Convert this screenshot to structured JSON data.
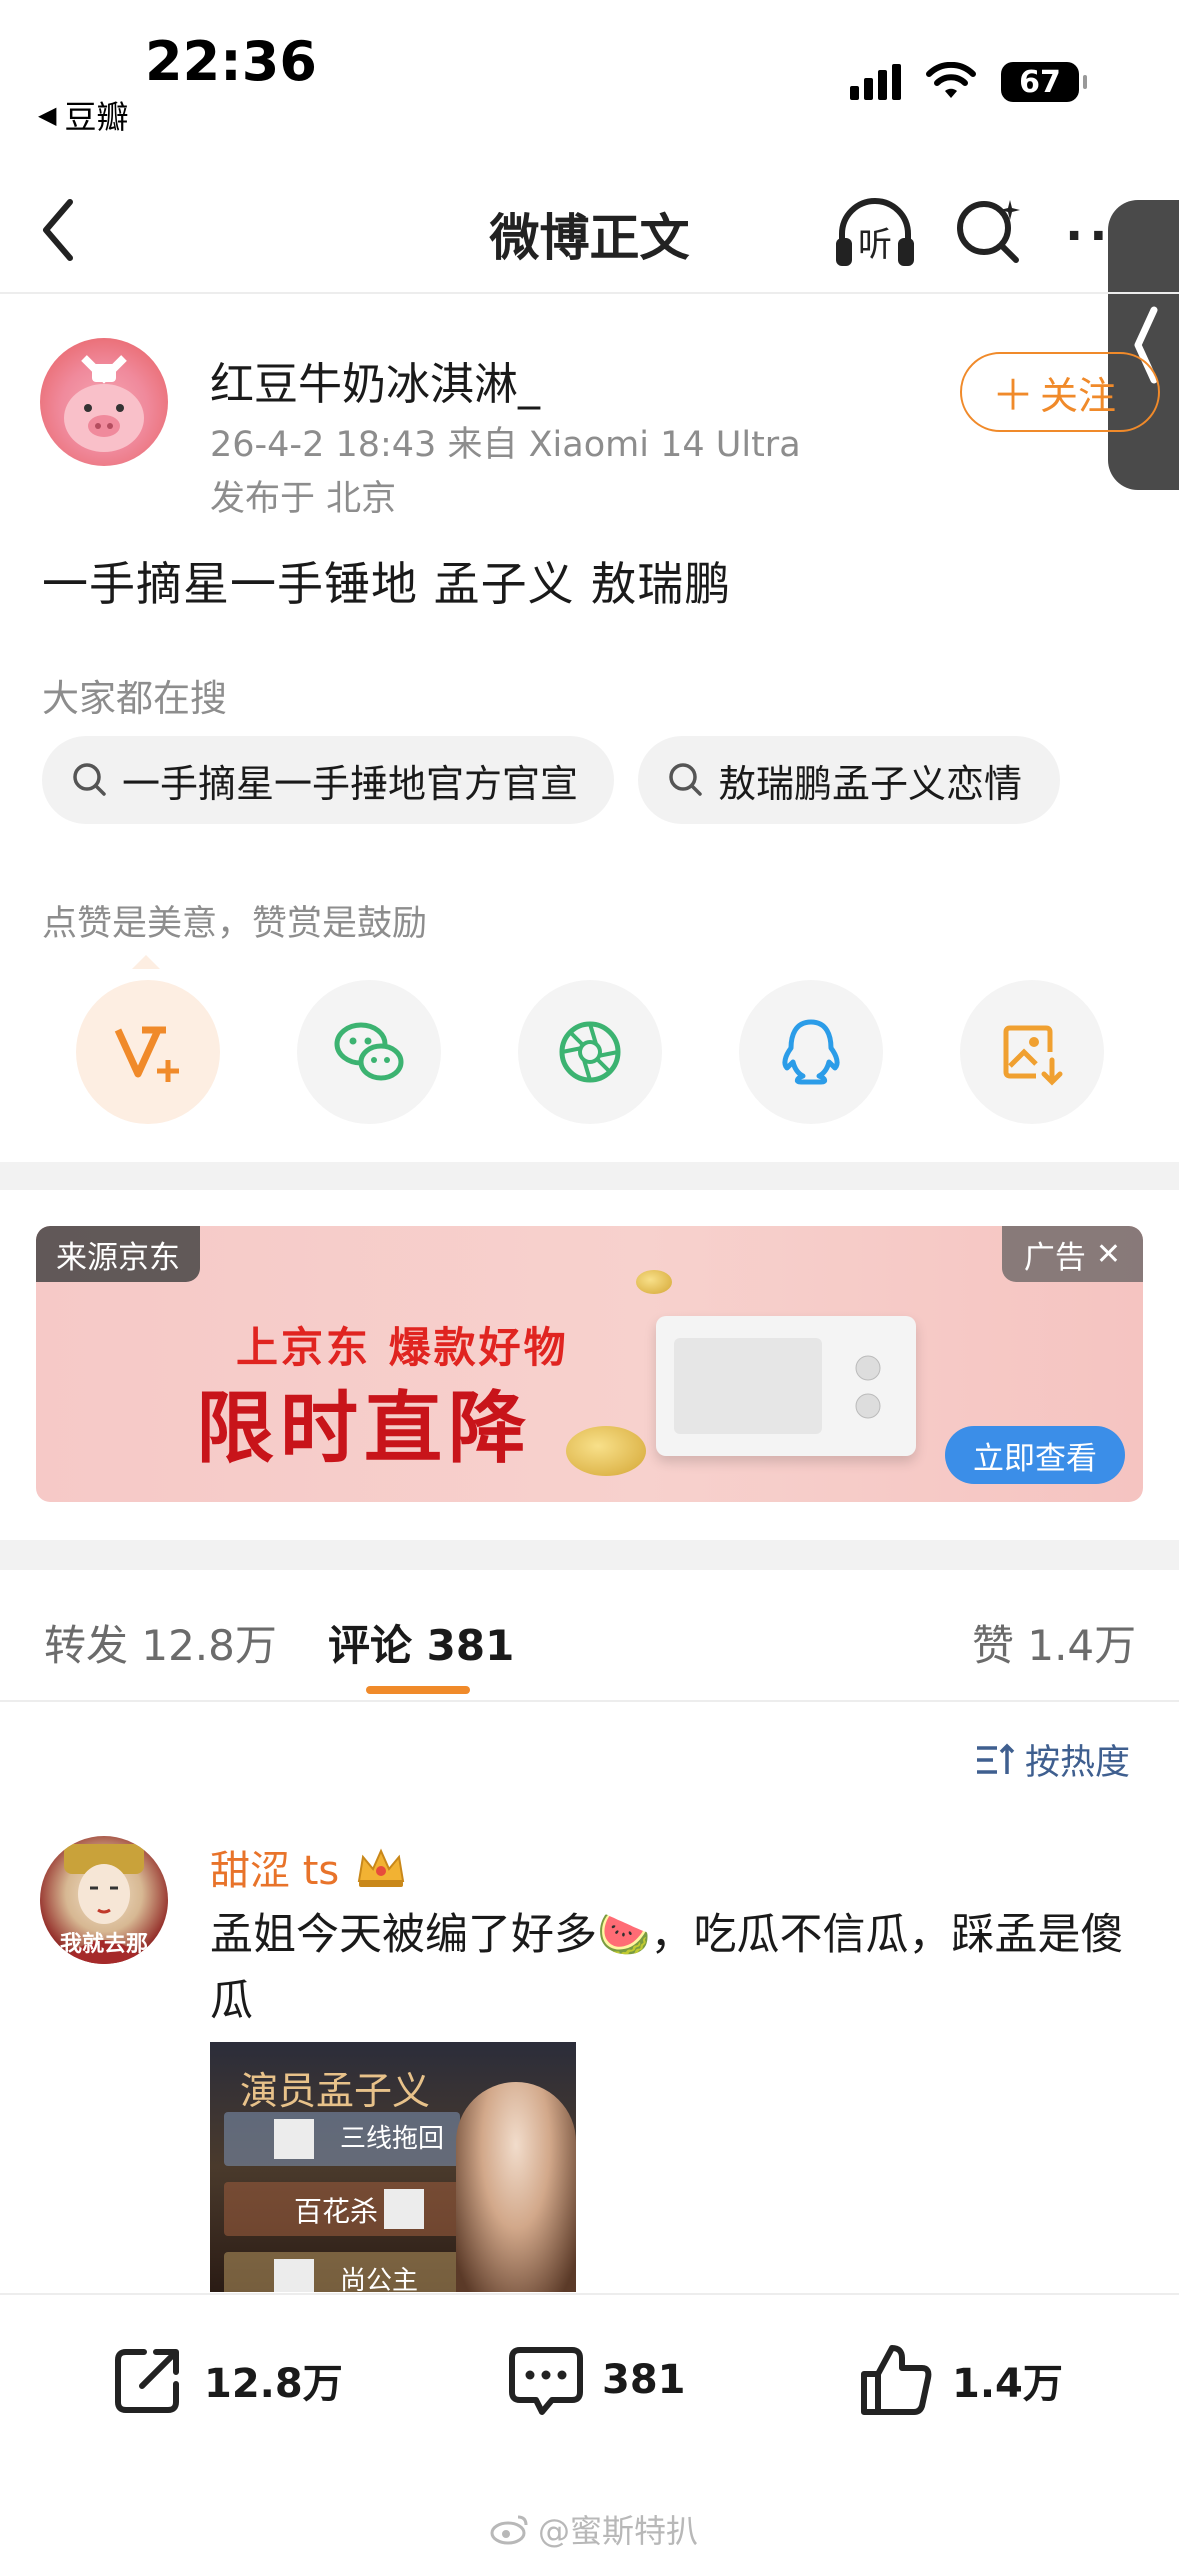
{
  "status_bar": {
    "time": "22:36",
    "back_app": "豆瓣",
    "battery": "67"
  },
  "nav": {
    "title": "微博正文",
    "listen_label": "听"
  },
  "post": {
    "author": "红豆牛奶冰淇淋_",
    "meta": "26-4-2 18:43  来自 Xiaomi 14 Ultra",
    "location": "发布于 北京",
    "follow_label": "关注",
    "text": "一手摘星一手锤地  孟子义 敖瑞鹏"
  },
  "searching": {
    "label": "大家都在搜",
    "chips": [
      "一手摘星一手捶地官方官宣",
      "敖瑞鹏孟子义恋情"
    ]
  },
  "reward": {
    "label": "点赞是美意，赞赏是鼓励",
    "share_icons": [
      "reward-v-plus-icon",
      "wechat-icon",
      "moments-icon",
      "qq-icon",
      "save-image-icon"
    ]
  },
  "ad": {
    "source": "来源京东",
    "tag": "广告",
    "line1": "上京东 爆款好物",
    "line2": "限时直降",
    "button": "立即查看"
  },
  "tabs": {
    "repost": "转发 12.8万",
    "comments": "评论 381",
    "likes": "赞 1.4万"
  },
  "sort_label": "按热度",
  "comment": {
    "author": "甜涩 ts",
    "avatar_text": "我就去那",
    "text": "孟姐今天被编了好多🍉，吃瓜不信瓜，踩孟是傻瓜",
    "image_title": "演员孟子义",
    "image_labels": [
      "三线拖回",
      "百花杀",
      "尚公主"
    ]
  },
  "bottom_bar": {
    "repost": "12.8万",
    "comments": "381",
    "likes": "1.4万"
  },
  "watermark": "@蜜斯特扒",
  "colors": {
    "accent_orange": "#f08a2a",
    "link_blue": "#3f5f8f",
    "ad_red": "#c8141a"
  }
}
